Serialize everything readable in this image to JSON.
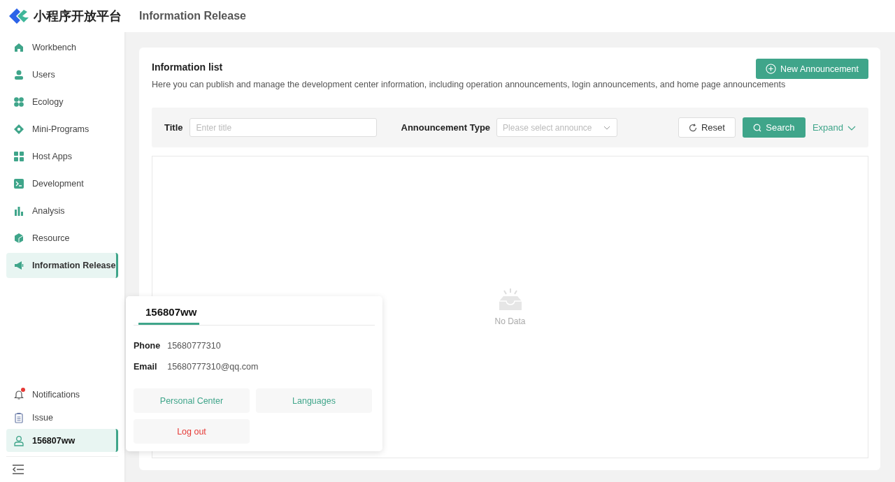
{
  "brand": {
    "name": "小程序开放平台"
  },
  "header": {
    "title": "Information Release"
  },
  "sidebar": {
    "items": [
      {
        "kind": "home",
        "label": "Workbench",
        "selected": false
      },
      {
        "kind": "user",
        "label": "Users",
        "selected": false
      },
      {
        "kind": "ecology",
        "label": "Ecology",
        "selected": false
      },
      {
        "kind": "diamond",
        "label": "Mini-Programs",
        "selected": false
      },
      {
        "kind": "grid",
        "label": "Host Apps",
        "selected": false
      },
      {
        "kind": "terminal",
        "label": "Development",
        "selected": false
      },
      {
        "kind": "chart",
        "label": "Analysis",
        "selected": false
      },
      {
        "kind": "cube",
        "label": "Resource",
        "selected": false
      },
      {
        "kind": "megaphone",
        "label": "Information Release",
        "selected": true
      }
    ],
    "bottom_items": [
      {
        "kind": "bell",
        "label": "Notifications",
        "selected": false,
        "badge": true
      },
      {
        "kind": "clipboard",
        "label": "Issue",
        "selected": false,
        "badge": false
      },
      {
        "kind": "person",
        "label": "156807ww",
        "selected": true,
        "badge": false
      }
    ]
  },
  "card": {
    "title": "Information list",
    "description": "Here you can publish and manage the development center information, including operation announcements, login announcements, and home page announcements",
    "new_button": "New Announcement",
    "filters": {
      "title_label": "Title",
      "title_placeholder": "Enter title",
      "type_label": "Announcement Type",
      "type_placeholder": "Please select announce",
      "reset": "Reset",
      "search": "Search",
      "expand": "Expand"
    },
    "empty": "No Data"
  },
  "user_popup": {
    "tab": "156807ww",
    "fields": [
      {
        "label": "Phone",
        "value": "15680777310"
      },
      {
        "label": "Email",
        "value": "15680777310@qq.com"
      }
    ],
    "buttons": [
      {
        "kind": "normal",
        "label": "Personal Center"
      },
      {
        "kind": "normal",
        "label": "Languages"
      },
      {
        "kind": "danger",
        "label": "Log out"
      }
    ]
  }
}
